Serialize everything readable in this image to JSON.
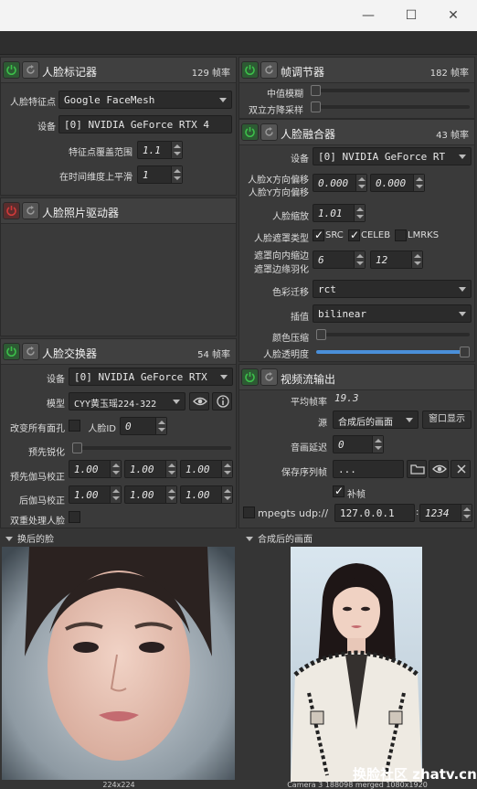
{
  "colors": {
    "accent": "#4a8fd9",
    "on": "#3cbf4a",
    "off": "#d03a3a"
  },
  "window": {
    "minimize": "—",
    "maximize": "☐",
    "close": "✕"
  },
  "face_marker": {
    "title": "人脸标记器",
    "fps": "129 帧率",
    "landmarks_label": "人脸特征点",
    "landmarks_value": "Google FaceMesh",
    "device_label": "设备",
    "device_value": "[0] NVIDIA GeForce RTX 4",
    "coverage_label": "特征点覆盖范围",
    "coverage_value": "1.1",
    "smooth_label": "在时间维度上平滑",
    "smooth_value": "1"
  },
  "face_animator": {
    "title": "人脸照片驱动器"
  },
  "face_swapper": {
    "title": "人脸交换器",
    "fps": "54 帧率",
    "device_label": "设备",
    "device_value": "[0] NVIDIA GeForce RTX",
    "model_label": "模型",
    "model_value": "CYY黄玉瑶224-322",
    "swap_all_label": "改变所有面孔",
    "face_id_label": "人脸ID",
    "face_id_value": "0",
    "presharpen_label": "预先锐化",
    "pre_gamma_label": "预先伽马校正",
    "pre_gamma": [
      "1.00",
      "1.00",
      "1.00"
    ],
    "post_gamma_label": "后伽马校正",
    "post_gamma": [
      "1.00",
      "1.00",
      "1.00"
    ],
    "two_pass_label": "双重处理人脸"
  },
  "frame_adjuster": {
    "title": "帧调节器",
    "fps": "182 帧率",
    "median_label": "中值模糊",
    "bilateral_label": "双立方降采样"
  },
  "face_merger": {
    "title": "人脸融合器",
    "fps": "43 帧率",
    "device_label": "设备",
    "device_value": "[0] NVIDIA GeForce RT",
    "offset_x_label": "人脸X方向偏移",
    "offset_y_label": "人脸Y方向偏移",
    "offset_x_value": "0.000",
    "offset_y_value": "0.000",
    "scale_label": "人脸缩放",
    "scale_value": "1.01",
    "mask_type_label": "人脸遮罩类型",
    "mask_src": "SRC",
    "mask_celeb": "CELEB",
    "mask_lmrks": "LMRKS",
    "erode_label": "遮罩向内缩边",
    "blur_label": "遮罩边缘羽化",
    "erode_value": "6",
    "blur_value": "12",
    "color_transfer_label": "色彩迁移",
    "color_transfer_value": "rct",
    "interp_label": "插值",
    "interp_value": "bilinear",
    "color_compress_label": "颜色压缩",
    "opacity_label": "人脸透明度",
    "opacity": 1.0
  },
  "stream_output": {
    "title": "视频流输出",
    "avg_fps_label": "平均帧率",
    "avg_fps_value": "19.3",
    "source_label": "源",
    "source_value": "合成后的画面",
    "window_btn": "窗口显示",
    "delay_label": "音画延迟",
    "delay_value": "0",
    "save_seq_label": "保存序列帧",
    "save_seq_value": "...",
    "fill_frames_label": "补帧",
    "mpegts_label": "mpegts udp://",
    "address": "127.0.0.1",
    "colon": ":",
    "port": "1234"
  },
  "previews": {
    "swapped_title": "换后的脸",
    "swapped_caption": "224x224",
    "merged_title": "合成后的画面",
    "merged_caption": "Camera 3 188098 merged 1080x1920",
    "watermark": "换脸社区 zhatv.cn"
  }
}
